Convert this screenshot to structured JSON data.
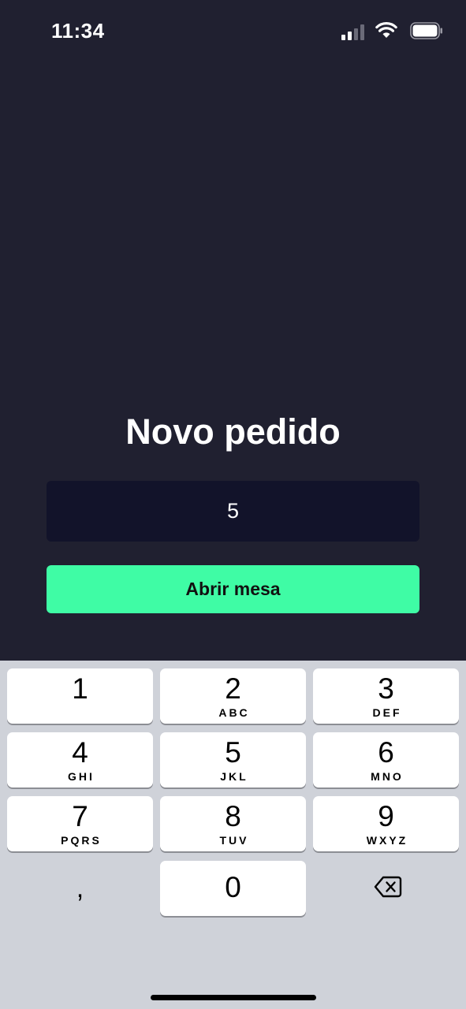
{
  "status_bar": {
    "time": "11:34",
    "icons": [
      "signal-icon",
      "wifi-icon",
      "battery-icon"
    ]
  },
  "screen": {
    "title": "Novo pedido",
    "table_input_value": "5",
    "open_button_label": "Abrir mesa"
  },
  "colors": {
    "background": "#202030",
    "input_background": "#12132a",
    "accent": "#3ffca5",
    "keyboard_background": "#cfd2d9"
  },
  "keyboard": {
    "keys": [
      {
        "num": "1",
        "letters": ""
      },
      {
        "num": "2",
        "letters": "ABC"
      },
      {
        "num": "3",
        "letters": "DEF"
      },
      {
        "num": "4",
        "letters": "GHI"
      },
      {
        "num": "5",
        "letters": "JKL"
      },
      {
        "num": "6",
        "letters": "MNO"
      },
      {
        "num": "7",
        "letters": "PQRS"
      },
      {
        "num": "8",
        "letters": "TUV"
      },
      {
        "num": "9",
        "letters": "WXYZ"
      },
      {
        "num": "0",
        "letters": ""
      }
    ],
    "comma": ",",
    "delete_icon": "delete-icon"
  }
}
